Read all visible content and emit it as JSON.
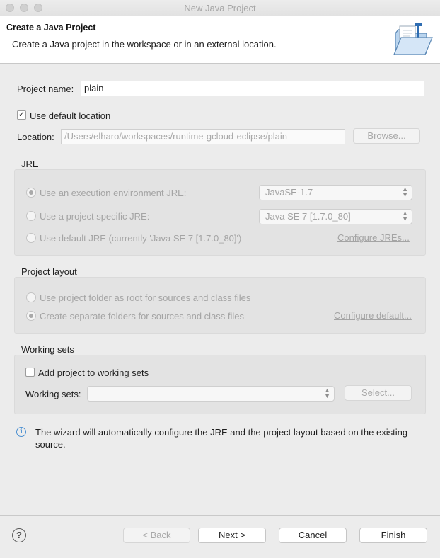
{
  "window": {
    "title": "New Java Project"
  },
  "banner": {
    "title": "Create a Java Project",
    "description": "Create a Java project in the workspace or in an external location."
  },
  "project_name": {
    "label": "Project name:",
    "value": "plain"
  },
  "default_location": {
    "label": "Use default location",
    "checked": true
  },
  "location": {
    "label": "Location:",
    "value": "/Users/elharo/workspaces/runtime-gcloud-eclipse/plain",
    "browse_label": "Browse..."
  },
  "jre": {
    "title": "JRE",
    "options": [
      {
        "label": "Use an execution environment JRE:",
        "selected": true
      },
      {
        "label": "Use a project specific JRE:",
        "selected": false
      },
      {
        "label": "Use default JRE (currently 'Java SE 7 [1.7.0_80]')",
        "selected": false
      }
    ],
    "execution_env_value": "JavaSE-1.7",
    "project_jre_value": "Java SE 7 [1.7.0_80]",
    "configure_link": "Configure JREs..."
  },
  "layout": {
    "title": "Project layout",
    "options": [
      {
        "label": "Use project folder as root for sources and class files",
        "selected": false
      },
      {
        "label": "Create separate folders for sources and class files",
        "selected": true
      }
    ],
    "configure_link": "Configure default..."
  },
  "working_sets": {
    "title": "Working sets",
    "add_label": "Add project to working sets",
    "checked": false,
    "label": "Working sets:",
    "value": "",
    "select_label": "Select..."
  },
  "info": {
    "text": "The wizard will automatically configure the JRE and the project layout based on the existing source."
  },
  "footer": {
    "back": "< Back",
    "next": "Next >",
    "cancel": "Cancel",
    "finish": "Finish"
  }
}
